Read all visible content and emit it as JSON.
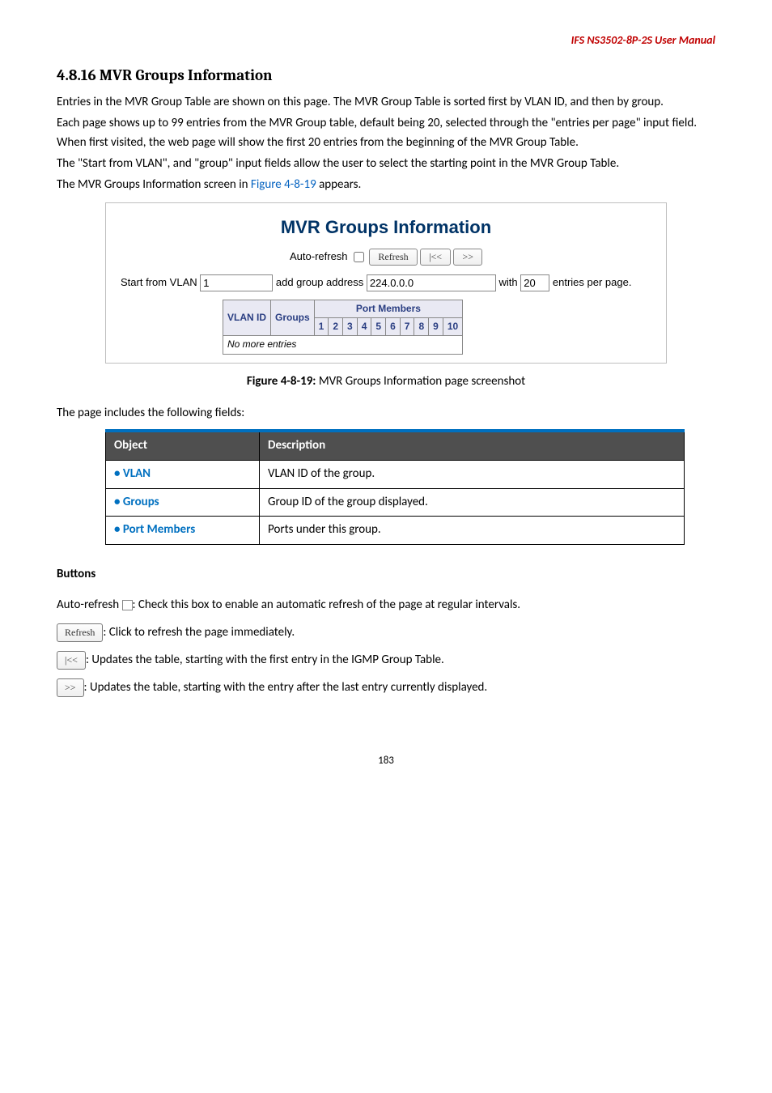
{
  "header": {
    "product": "IFS NS3502-8P-2S  User Manual"
  },
  "section": {
    "heading": "4.8.16 MVR Groups Information"
  },
  "intro": {
    "p1": "Entries in the MVR Group Table are shown on this page. The MVR Group Table is sorted first by VLAN ID, and then by group.",
    "p2": "Each page shows up to 99 entries from the MVR Group table, default being 20, selected through the \"entries per page\" input field. When first visited, the web page will show the first 20 entries from the beginning of the MVR Group Table.",
    "p3": "The \"Start from VLAN\", and \"group\" input fields allow the user to select the starting point in the MVR Group Table.",
    "p4a": "The MVR Groups Information screen in ",
    "p4link": "Figure 4-8-19",
    "p4b": " appears."
  },
  "figure_ui": {
    "title": "MVR Groups Information",
    "auto_refresh_label": "Auto-refresh",
    "refresh_btn": "Refresh",
    "prev_btn": "|<<",
    "next_btn": ">>",
    "start_from_label": "Start from VLAN ",
    "start_from_value": "1",
    "addr_label": " add group address ",
    "addr_value": "224.0.0.0",
    "with_label": " with ",
    "with_value": "20",
    "entries_label": " entries per page.",
    "col_vlan": "VLAN ID",
    "col_groups": "Groups",
    "col_ports": "Port Members",
    "ports": [
      "1",
      "2",
      "3",
      "4",
      "5",
      "6",
      "7",
      "8",
      "9",
      "10"
    ],
    "no_entries": "No more entries"
  },
  "figure_caption": {
    "strong": "Figure 4-8-19:",
    "rest": " MVR Groups Information page screenshot"
  },
  "fields_intro": "The page includes the following fields:",
  "desc_table": {
    "head_object": "Object",
    "head_desc": "Description",
    "rows": [
      {
        "obj": "VLAN",
        "desc": "VLAN ID of the group."
      },
      {
        "obj": "Groups",
        "desc": "Group ID of the group displayed."
      },
      {
        "obj": "Port Members",
        "desc": "Ports under this group."
      }
    ]
  },
  "buttons_section": {
    "heading": "Buttons",
    "auto_label": "Auto-refresh ",
    "auto_desc": ": Check this box to enable an automatic refresh of the page at regular intervals.",
    "refresh_btn": "Refresh",
    "refresh_desc": ": Click to refresh the page immediately.",
    "prev_btn": "|<<",
    "prev_desc": ": Updates the table, starting with the first entry in the IGMP Group Table.",
    "next_btn": ">>",
    "next_desc": ": Updates the table, starting with the entry after the last entry currently displayed."
  },
  "page_number": "183"
}
